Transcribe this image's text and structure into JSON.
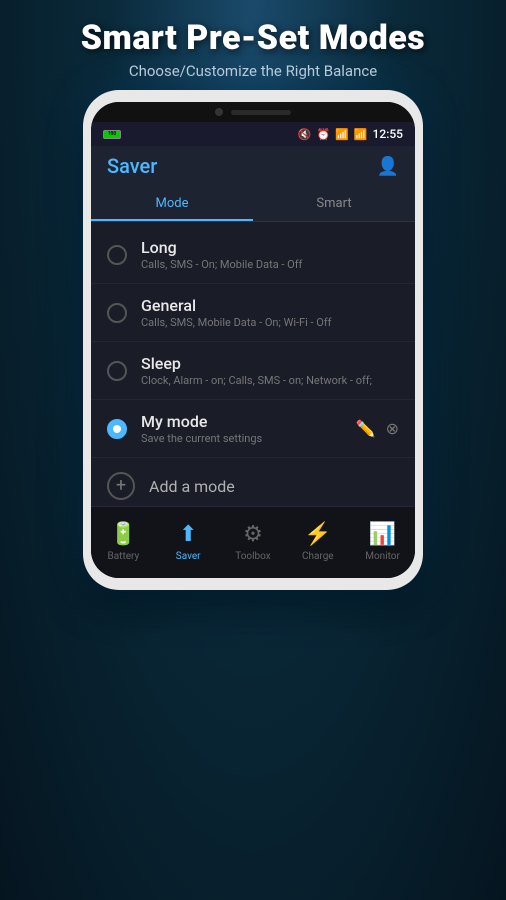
{
  "header": {
    "title": "Smart Pre-Set Modes",
    "subtitle": "Choose/Customize the Right Balance"
  },
  "statusBar": {
    "battery": "100",
    "time": "12:55"
  },
  "appHeader": {
    "title": "Saver"
  },
  "tabs": [
    {
      "label": "Mode",
      "active": true
    },
    {
      "label": "Smart",
      "active": false
    }
  ],
  "modes": [
    {
      "name": "Long",
      "desc": "Calls, SMS - On; Mobile Data - Off",
      "active": false
    },
    {
      "name": "General",
      "desc": "Calls, SMS, Mobile Data - On; Wi-Fi - Off",
      "active": false
    },
    {
      "name": "Sleep",
      "desc": "Clock, Alarm - on; Calls, SMS - on; Network - off;",
      "active": false
    },
    {
      "name": "My mode",
      "desc": "Save the current settings",
      "active": true,
      "editable": true
    }
  ],
  "addMode": {
    "label": "Add a mode"
  },
  "bottomNav": [
    {
      "label": "Battery",
      "icon": "battery",
      "active": false
    },
    {
      "label": "Saver",
      "icon": "saver",
      "active": true
    },
    {
      "label": "Toolbox",
      "icon": "toolbox",
      "active": false
    },
    {
      "label": "Charge",
      "icon": "charge",
      "active": false
    },
    {
      "label": "Monitor",
      "icon": "monitor",
      "active": false
    }
  ]
}
